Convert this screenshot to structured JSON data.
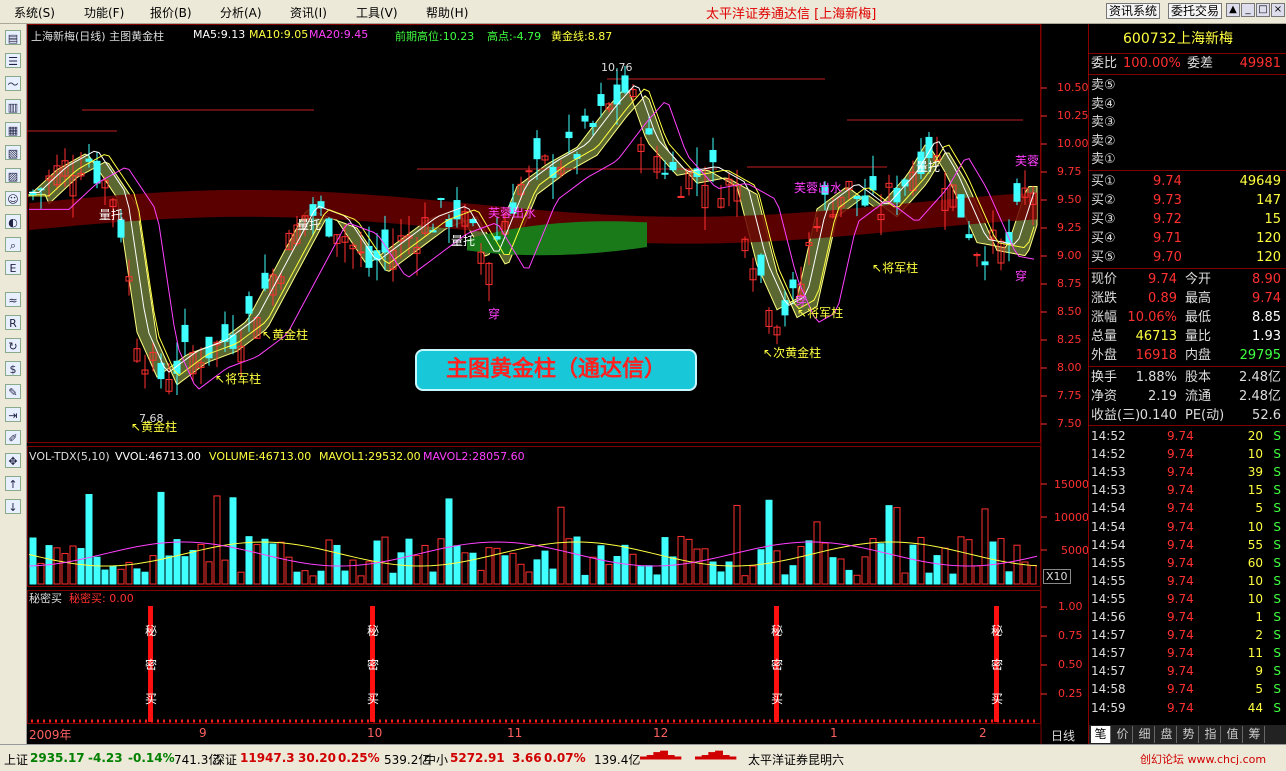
{
  "menu": [
    "系统(S)",
    "功能(F)",
    "报价(B)",
    "分析(A)",
    "资讯(I)",
    "工具(V)",
    "帮助(H)"
  ],
  "app_title": "太平洋证券通达信 [上海新梅]",
  "right_buttons": [
    "资讯系统",
    "委托交易"
  ],
  "window_buttons": [
    "▲",
    "_",
    "□",
    "×"
  ],
  "chart": {
    "header_title": "上海新梅(日线) 主图黄金柱",
    "ma5": "MA5:9.13",
    "ma10": "MA10:9.05",
    "ma20": "MA20:9.45",
    "prev_high": "前期高位:10.23",
    "high_point": "高点:-4.79",
    "golden_line": "黄金线:8.87",
    "price_ticks": [
      "10.50",
      "10.25",
      "10.00",
      "9.75",
      "9.50",
      "9.25",
      "9.00",
      "8.75",
      "8.50",
      "8.25",
      "8.00",
      "7.75",
      "7.50"
    ],
    "high_label": "10.76",
    "low_label": "7.68",
    "banner": "主图黄金柱（通达信）",
    "annotations": {
      "liang_tuo": "量托",
      "huang_jin_zhu": "黄金柱",
      "jiang_jun_zhu": "将军柱",
      "fu_rong_chu_shui": "芙蓉出水",
      "fu_rong": "芙蓉",
      "chuan": "穿",
      "ci_huang_jin_zhu": "次黄金柱"
    },
    "vol_header": "VOL-TDX(5,10)",
    "vvol": "VVOL:46713.00",
    "volume": "VOLUME:46713.00",
    "mavol1": "MAVOL1:29532.00",
    "mavol2": "MAVOL2:28057.60",
    "vol_ticks": [
      "15000",
      "10000",
      "5000"
    ],
    "vol_unit": "X10",
    "secret_header": "秘密买",
    "secret_value": "秘密买: 0.00",
    "secret_ticks": [
      "1.00",
      "0.75",
      "0.50",
      "0.25"
    ],
    "secret_chars": [
      "秘",
      "密",
      "买"
    ],
    "dates": [
      "2009年",
      "9",
      "10",
      "11",
      "12",
      "1",
      "2"
    ],
    "period": "日线"
  },
  "quote": {
    "code": "600732",
    "name": "上海新梅",
    "wei_bi_label": "委比",
    "wei_bi": "100.00%",
    "wei_cha_label": "委差",
    "wei_cha": "49981",
    "sells": [
      "卖⑤",
      "卖④",
      "卖③",
      "卖②",
      "卖①"
    ],
    "buys": [
      {
        "label": "买①",
        "price": "9.74",
        "vol": "49649"
      },
      {
        "label": "买②",
        "price": "9.73",
        "vol": "147"
      },
      {
        "label": "买③",
        "price": "9.72",
        "vol": "15"
      },
      {
        "label": "买④",
        "price": "9.71",
        "vol": "120"
      },
      {
        "label": "买⑤",
        "price": "9.70",
        "vol": "120"
      }
    ],
    "stats": [
      {
        "l1": "现价",
        "v1": "9.74",
        "l2": "今开",
        "v2": "8.90",
        "c1": "#ff3030",
        "c2": "#ff3030"
      },
      {
        "l1": "涨跌",
        "v1": "0.89",
        "l2": "最高",
        "v2": "9.74",
        "c1": "#ff3030",
        "c2": "#ff3030"
      },
      {
        "l1": "涨幅",
        "v1": "10.06%",
        "l2": "最低",
        "v2": "8.85",
        "c1": "#ff3030",
        "c2": "#ffffff"
      },
      {
        "l1": "总量",
        "v1": "46713",
        "l2": "量比",
        "v2": "1.93",
        "c1": "#ffff40",
        "c2": "#ffffff"
      },
      {
        "l1": "外盘",
        "v1": "16918",
        "l2": "内盘",
        "v2": "29795",
        "c1": "#ff3030",
        "c2": "#40ff40"
      }
    ],
    "stats2": [
      {
        "l1": "换手",
        "v1": "1.88%",
        "l2": "股本",
        "v2": "2.48亿"
      },
      {
        "l1": "净资",
        "v1": "2.19",
        "l2": "流通",
        "v2": "2.48亿"
      },
      {
        "l1": "收益(三)",
        "v1": "0.140",
        "l2": "PE(动)",
        "v2": "52.6"
      }
    ],
    "ticks": [
      {
        "time": "14:52",
        "price": "9.74",
        "vol": "20",
        "side": "S"
      },
      {
        "time": "14:52",
        "price": "9.74",
        "vol": "10",
        "side": "S"
      },
      {
        "time": "14:53",
        "price": "9.74",
        "vol": "39",
        "side": "S"
      },
      {
        "time": "14:53",
        "price": "9.74",
        "vol": "15",
        "side": "S"
      },
      {
        "time": "14:54",
        "price": "9.74",
        "vol": "5",
        "side": "S"
      },
      {
        "time": "14:54",
        "price": "9.74",
        "vol": "10",
        "side": "S"
      },
      {
        "time": "14:54",
        "price": "9.74",
        "vol": "55",
        "side": "S"
      },
      {
        "time": "14:55",
        "price": "9.74",
        "vol": "60",
        "side": "S"
      },
      {
        "time": "14:55",
        "price": "9.74",
        "vol": "10",
        "side": "S"
      },
      {
        "time": "14:55",
        "price": "9.74",
        "vol": "10",
        "side": "S"
      },
      {
        "time": "14:56",
        "price": "9.74",
        "vol": "1",
        "side": "S"
      },
      {
        "time": "14:57",
        "price": "9.74",
        "vol": "2",
        "side": "S"
      },
      {
        "time": "14:57",
        "price": "9.74",
        "vol": "11",
        "side": "S"
      },
      {
        "time": "14:57",
        "price": "9.74",
        "vol": "9",
        "side": "S"
      },
      {
        "time": "14:58",
        "price": "9.74",
        "vol": "5",
        "side": "S"
      },
      {
        "time": "14:59",
        "price": "9.74",
        "vol": "44",
        "side": "S"
      }
    ],
    "tabs": [
      "笔",
      "价",
      "细",
      "盘",
      "势",
      "指",
      "值",
      "筹"
    ]
  },
  "status": {
    "sh_label": "上证",
    "sh_index": "2935.17",
    "sh_change": "-4.23",
    "sh_pct": "-0.14%",
    "sh_amount": "741.3亿",
    "sz_label": "深证",
    "sz_index": "11947.3",
    "sz_change": "30.20",
    "sz_pct": "0.25%",
    "sz_amount": "539.2亿",
    "zx_label": "中小",
    "zx_index": "5272.91",
    "zx_change": "3.66",
    "zx_pct": "0.07%",
    "zx_amount": "139.4亿",
    "broker": "太平洋证券昆明六",
    "watermark": "创幻论坛 www.chcj.com"
  },
  "colors": {
    "up": "#ff3030",
    "down": "#40ffff",
    "frame": "#800000",
    "yellow": "#ffff40",
    "magenta": "#ff40ff"
  },
  "chart_data": {
    "type": "candlestick",
    "title": "上海新梅(日线) 主图黄金柱",
    "y_range": [
      7.5,
      10.76
    ],
    "ma": {
      "MA5": 9.13,
      "MA10": 9.05,
      "MA20": 9.45
    },
    "price_high": 10.76,
    "price_low": 7.68,
    "volume_latest": 46713,
    "mavol1": 29532,
    "mavol2": 28057.6
  }
}
